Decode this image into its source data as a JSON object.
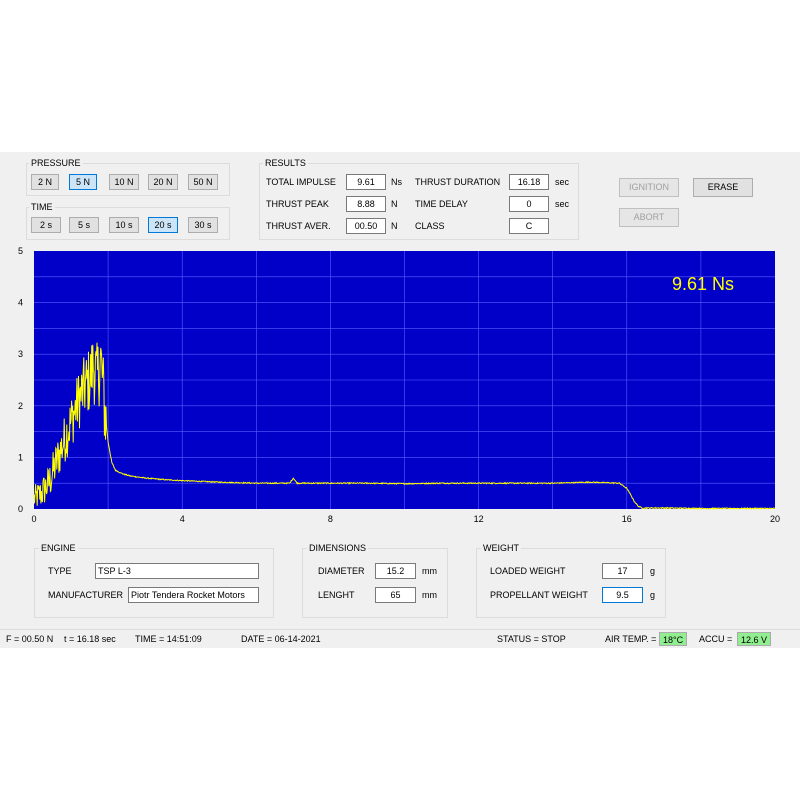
{
  "pressure": {
    "title": "PRESSURE",
    "options": [
      "2 N",
      "5 N",
      "10 N",
      "20 N",
      "50 N"
    ],
    "selected": "5 N"
  },
  "time": {
    "title": "TIME",
    "options": [
      "2 s",
      "5 s",
      "10 s",
      "20 s",
      "30 s"
    ],
    "selected": "20 s"
  },
  "results": {
    "title": "RESULTS",
    "total_impulse_label": "TOTAL IMPULSE",
    "total_impulse_value": "9.61",
    "total_impulse_unit": "Ns",
    "thrust_peak_label": "THRUST PEAK",
    "thrust_peak_value": "8.88",
    "thrust_peak_unit": "N",
    "thrust_aver_label": "THRUST AVER.",
    "thrust_aver_value": "00.50",
    "thrust_aver_unit": "N",
    "thrust_duration_label": "THRUST DURATION",
    "thrust_duration_value": "16.18",
    "thrust_duration_unit": "sec",
    "time_delay_label": "TIME DELAY",
    "time_delay_value": "0",
    "time_delay_unit": "sec",
    "class_label": "CLASS",
    "class_value": "C"
  },
  "actions": {
    "ignition": "IGNITION",
    "abort": "ABORT",
    "erase": "ERASE"
  },
  "chart_data": {
    "type": "line",
    "annotation": "9.61 Ns",
    "xlim": [
      0,
      20
    ],
    "ylim": [
      0,
      5
    ],
    "x_ticks": [
      "0",
      "4",
      "8",
      "12",
      "16",
      "20"
    ],
    "y_ticks": [
      "0",
      "1",
      "2",
      "3",
      "4",
      "5"
    ],
    "grid": true,
    "background_color": "#0000c8",
    "line_color": "#ffff00",
    "series": [
      {
        "x": [
          0,
          0.2,
          0.4,
          0.6,
          0.8,
          1.0,
          1.2,
          1.4,
          1.5,
          1.6,
          1.7,
          1.8,
          1.85,
          1.9,
          2.0,
          2.1,
          2.2,
          2.4,
          2.6,
          3.0,
          3.5,
          4.0,
          5.0,
          6.0,
          6.9,
          7.0,
          7.1,
          8.0,
          9.0,
          10.0,
          11.0,
          12.0,
          13.0,
          14.0,
          15.0,
          15.8,
          16.0,
          16.1,
          16.2,
          16.3,
          16.4,
          17.0,
          18.0,
          19.0,
          20.0
        ],
        "y": [
          0.2,
          0.3,
          0.5,
          0.9,
          1.3,
          1.7,
          2.1,
          2.4,
          2.5,
          2.8,
          2.5,
          2.9,
          2.5,
          2.0,
          1.3,
          0.9,
          0.75,
          0.68,
          0.64,
          0.6,
          0.57,
          0.55,
          0.52,
          0.5,
          0.5,
          0.6,
          0.5,
          0.5,
          0.5,
          0.49,
          0.5,
          0.5,
          0.5,
          0.5,
          0.52,
          0.5,
          0.4,
          0.28,
          0.15,
          0.06,
          0.02,
          0.02,
          0.01,
          0.01,
          0.01
        ]
      }
    ]
  },
  "engine": {
    "title": "ENGINE",
    "type_label": "TYPE",
    "type_value": "TSP L-3",
    "manufacturer_label": "MANUFACTURER",
    "manufacturer_value": "Piotr Tendera Rocket Motors"
  },
  "dimensions": {
    "title": "DIMENSIONS",
    "diameter_label": "DIAMETER",
    "diameter_value": "15.2",
    "diameter_unit": "mm",
    "length_label": "LENGHT",
    "length_value": "65",
    "length_unit": "mm"
  },
  "weight": {
    "title": "WEIGHT",
    "loaded_label": "LOADED WEIGHT",
    "loaded_value": "17",
    "loaded_unit": "g",
    "propellant_label": "PROPELLANT WEIGHT",
    "propellant_value": "9.5",
    "propellant_unit": "g"
  },
  "status": {
    "force": "F = 00.50 N",
    "t": "t = 16.18 sec",
    "time": "TIME = 14:51:09",
    "date": "DATE = 06-14-2021",
    "state": "STATUS = STOP",
    "air_temp_label": "AIR TEMP. =",
    "air_temp_value": "18°C",
    "accu_label": "ACCU =",
    "accu_value": "12.6 V"
  }
}
